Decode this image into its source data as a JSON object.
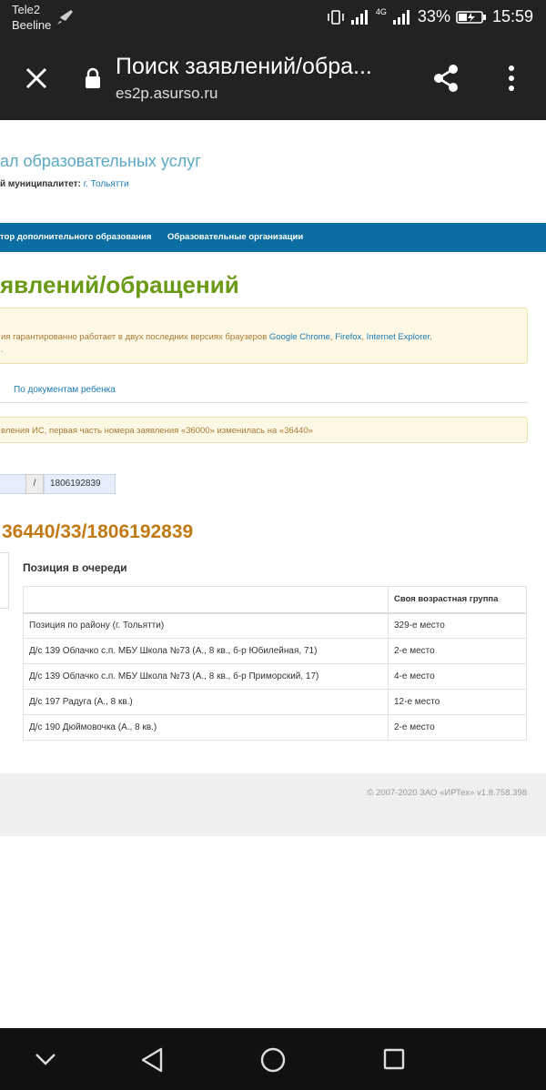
{
  "status_bar": {
    "carrier1": "Tele2",
    "carrier2": "Beeline",
    "network": "4G",
    "battery": "33%",
    "time": "15:59"
  },
  "browser": {
    "title": "Поиск заявлений/обра...",
    "url": "es2p.asurso.ru"
  },
  "header": {
    "portal_title": "ал образовательных услуг",
    "muni_label": "й муниципалитет:",
    "muni_value": "г. Тольятти"
  },
  "nav": {
    "items": [
      "тор дополнительного образования",
      "Образовательные организации"
    ]
  },
  "page_title": "явлений/обращений",
  "alert1": {
    "text": "ия гарантированно работает в двух последних версиях браузеров",
    "browser1": "Google Chrome",
    "sep1": ",",
    "browser2": "Firefox",
    "sep2": ",",
    "browser3": "Internet Explorer",
    "trail": ",",
    "line2": "."
  },
  "tabs": {
    "active": "По документам ребенка"
  },
  "alert2": {
    "text": "вления ИС, первая часть номера заявления «36000» изменилась на «36440»"
  },
  "search": {
    "separator": "/",
    "value": "1806192839"
  },
  "application_number": "36440/33/1806192839",
  "queue": {
    "title": "Позиция в очереди",
    "column_header": "Своя возрастная группа",
    "rows": [
      {
        "name": "Позиция по району (г. Тольятти)",
        "place": "329-е место"
      },
      {
        "name": "Д/с 139 Облачко с.п. МБУ Школа №73 (А., 8 кв., б-р Юбилейная, 71)",
        "place": "2-е место"
      },
      {
        "name": "Д/с 139 Облачко с.п. МБУ Школа №73 (А., 8 кв., б-р Приморский, 17)",
        "place": "4-е место"
      },
      {
        "name": "Д/с 197 Радуга (А., 8 кв.)",
        "place": "12-е место"
      },
      {
        "name": "Д/с 190 Дюймовочка (А., 8 кв.)",
        "place": "2-е место"
      }
    ]
  },
  "footer": {
    "copyright": "© 2007-2020 ЗАО «ИРТех» v1.8.758.398"
  }
}
